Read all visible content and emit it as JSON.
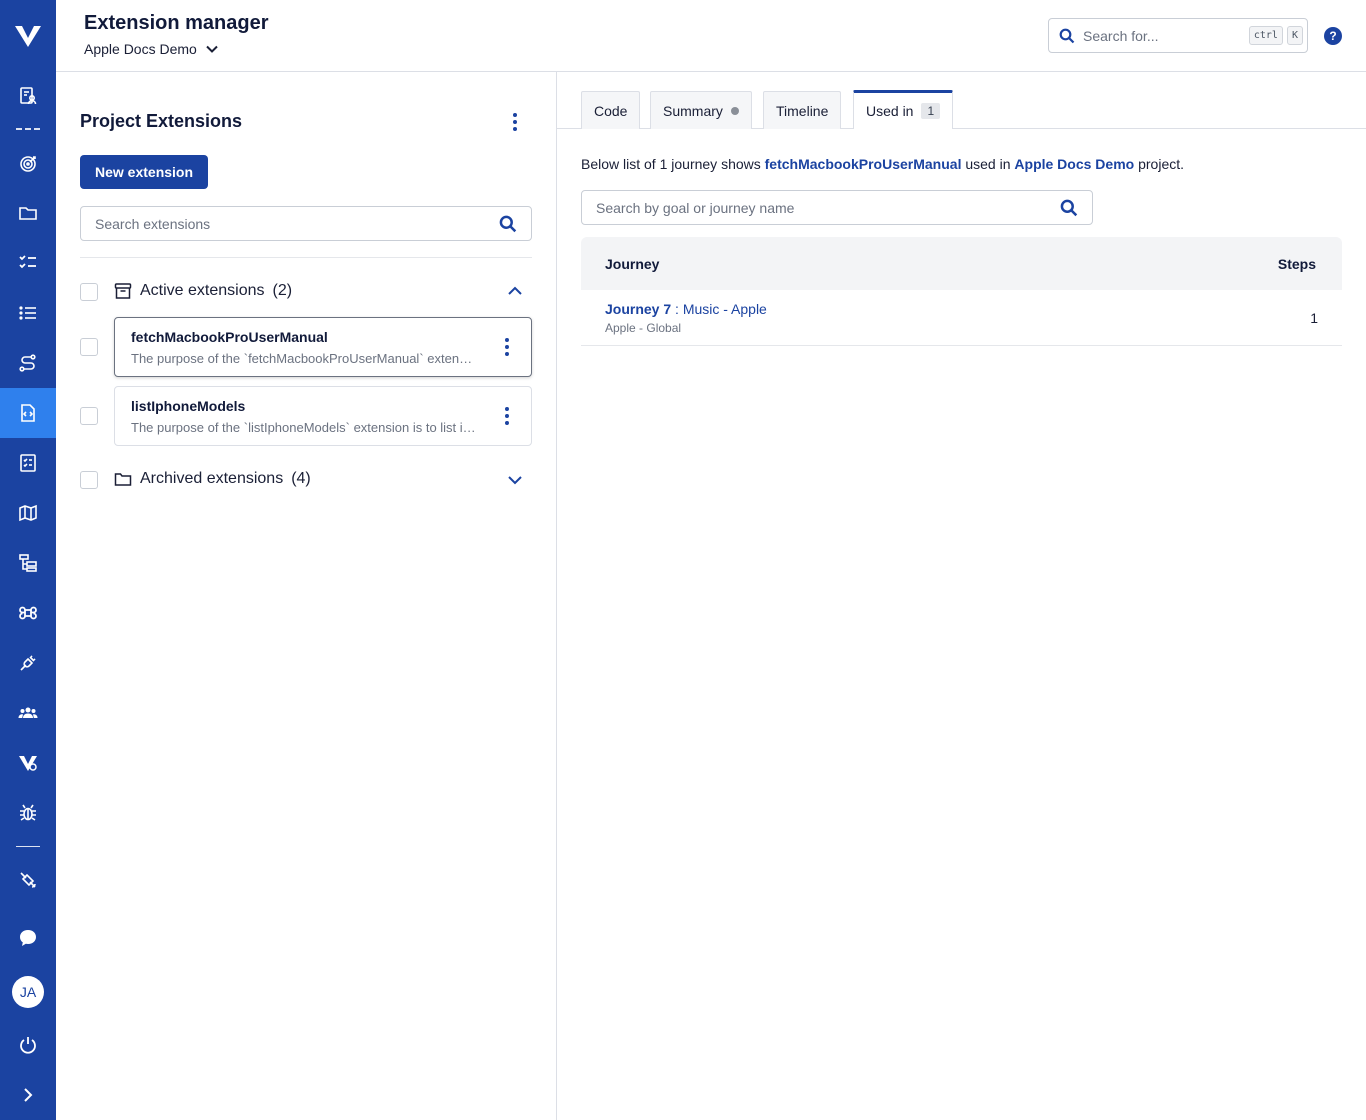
{
  "header": {
    "title": "Extension manager",
    "project": "Apple Docs Demo",
    "search_placeholder": "Search for...",
    "shortcut_key1": "ctrl",
    "shortcut_key2": "K",
    "help_glyph": "?"
  },
  "sidebar": {
    "avatar_initials": "JA",
    "items": [
      {
        "icon": "user-doc-icon"
      },
      {
        "icon": "target-icon"
      },
      {
        "icon": "folder-icon"
      },
      {
        "icon": "checklist-icon"
      },
      {
        "icon": "list-icon"
      },
      {
        "icon": "route-icon"
      },
      {
        "icon": "code-file-icon",
        "active": true
      },
      {
        "icon": "test-plan-icon"
      },
      {
        "icon": "map-icon"
      },
      {
        "icon": "hierarchy-icon"
      },
      {
        "icon": "command-icon"
      },
      {
        "icon": "plug-icon"
      },
      {
        "icon": "team-icon"
      },
      {
        "icon": "brand-settings-icon"
      },
      {
        "icon": "bug-icon"
      },
      {
        "icon": "satellite-icon"
      },
      {
        "icon": "chat-icon"
      },
      {
        "icon": "power-icon"
      },
      {
        "icon": "chevron-right-icon"
      }
    ]
  },
  "left_panel": {
    "title": "Project Extensions",
    "new_button": "New extension",
    "search_placeholder": "Search extensions",
    "active_group": {
      "label": "Active extensions",
      "count": "(2)"
    },
    "archived_group": {
      "label": "Archived extensions",
      "count": "(4)"
    },
    "extensions": [
      {
        "name": "fetchMacbookProUserManual",
        "description": "The purpose of the `fetchMacbookProUserManual` extension is to retrieve the MacBook Pro user manual"
      },
      {
        "name": "listIphoneModels",
        "description": "The purpose of the `listIphoneModels` extension is to list iPhone models"
      }
    ]
  },
  "right_panel": {
    "tabs": {
      "code": "Code",
      "summary": "Summary",
      "timeline": "Timeline",
      "used_in": "Used in",
      "used_in_count": "1"
    },
    "usage": {
      "prefix": "Below list of 1 journey shows ",
      "extension_name": "fetchMacbookProUserManual",
      "middle": " used in ",
      "project_name": "Apple Docs Demo",
      "suffix": " project."
    },
    "journey_search_placeholder": "Search by goal or journey name",
    "table": {
      "col_journey": "Journey",
      "col_steps": "Steps",
      "rows": [
        {
          "journey_number": "Journey 7",
          "separator": " : ",
          "journey_name": "Music - Apple",
          "subtitle": "Apple - Global",
          "steps": "1"
        }
      ]
    }
  }
}
